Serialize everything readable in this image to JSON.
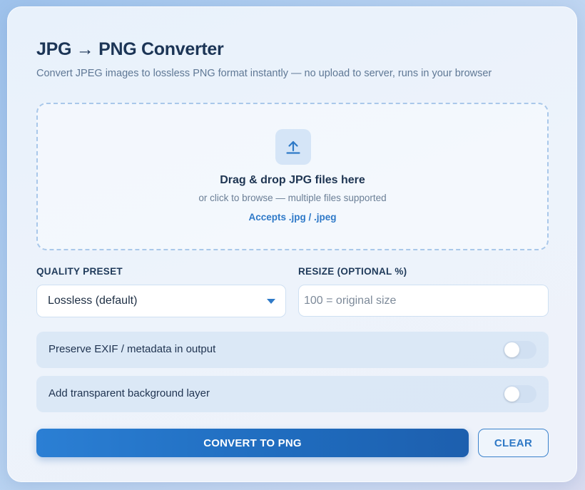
{
  "header": {
    "title": "JPG → PNG Converter",
    "subtitle": "Convert JPEG images to lossless PNG format instantly — no upload to server, runs in your browser"
  },
  "dropzone": {
    "icon": "upload-icon",
    "title": "Drag & drop JPG files here",
    "subtitle": "or click to browse — multiple files supported",
    "accepts": "Accepts .jpg / .jpeg"
  },
  "quality": {
    "label": "QUALITY PRESET",
    "selected": "Lossless (default)"
  },
  "resize": {
    "label": "RESIZE (OPTIONAL %)",
    "value": "",
    "placeholder": "100 = original size"
  },
  "options": [
    {
      "label": "Preserve EXIF / metadata in output",
      "enabled": false
    },
    {
      "label": "Add transparent background layer",
      "enabled": false
    }
  ],
  "actions": {
    "convert_label": "CONVERT TO PNG",
    "clear_label": "CLEAR"
  },
  "colors": {
    "accent": "#2b7fd4",
    "title": "#1c3556"
  }
}
